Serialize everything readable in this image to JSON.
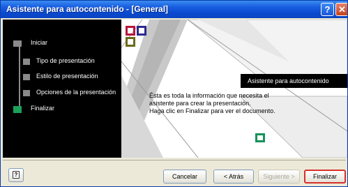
{
  "window": {
    "title": "Asistente para autocontenido - [General]",
    "help_glyph": "?",
    "close_glyph": "✕"
  },
  "steps": [
    {
      "label": "Iniciar",
      "active": false
    },
    {
      "label": "Tipo de presentación",
      "active": false
    },
    {
      "label": "Estilo de presentación",
      "active": false
    },
    {
      "label": "Opciones de la presentación",
      "active": false
    },
    {
      "label": "Finalizar",
      "active": true
    }
  ],
  "preview": {
    "tooltip": "Asistente para autocontenido",
    "info_lines": [
      "Ésta es toda la información que necesita el",
      "asistente para crear la presentación.",
      "Haga clic en Finalizar para ver el documento."
    ]
  },
  "footer": {
    "help_icon": "help-book-icon",
    "help_glyph": "?",
    "cancel_label": "Cancelar",
    "back_label": "< Atrás",
    "next_label": "Siguiente >",
    "finish_label": "Finalizar"
  },
  "colors": {
    "title_bar": "#0a4ad0",
    "step_active": "#1aa05a",
    "finish_border": "#d9302a"
  }
}
